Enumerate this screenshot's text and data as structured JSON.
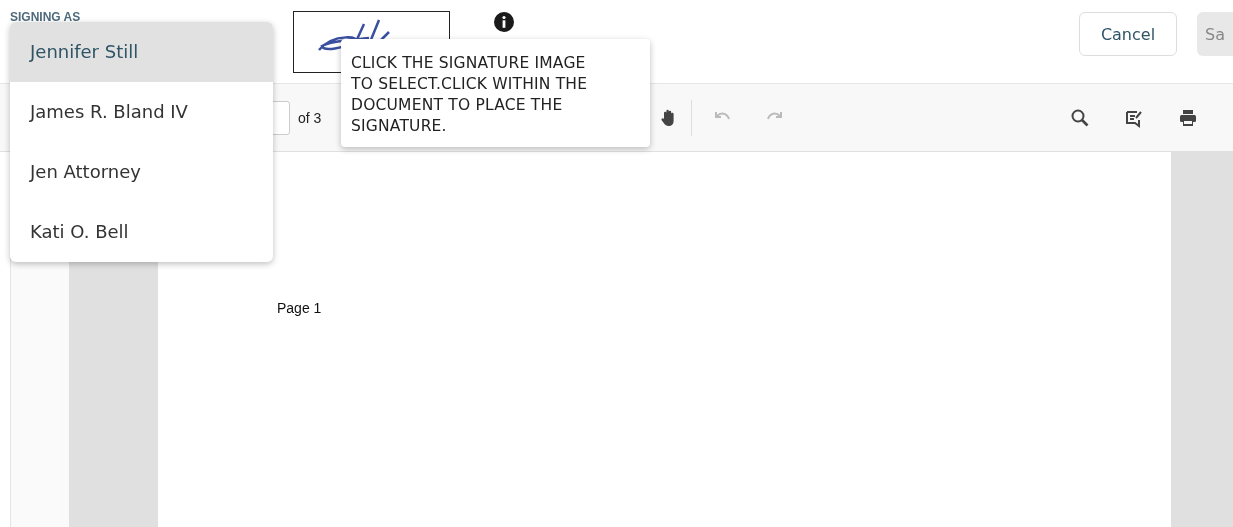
{
  "header": {
    "label": "SIGNING AS"
  },
  "signer_dropdown": {
    "options": [
      {
        "label": "Jennifer Still",
        "selected": true
      },
      {
        "label": "James R. Bland IV",
        "selected": false
      },
      {
        "label": "Jen Attorney",
        "selected": false
      },
      {
        "label": "Kati O. Bell",
        "selected": false
      }
    ]
  },
  "tooltip": {
    "text": "CLICK THE SIGNATURE IMAGE TO SELECT.CLICK WITHIN THE DOCUMENT TO PLACE THE SIGNATURE."
  },
  "buttons": [
    {
      "label": "Cancel",
      "disabled": false
    },
    {
      "label": "Sa",
      "disabled": true
    }
  ],
  "toolbar": {
    "page_count": "of 3",
    "undo_disabled": true,
    "redo_disabled": true
  },
  "document": {
    "page_text": "Page 1"
  }
}
